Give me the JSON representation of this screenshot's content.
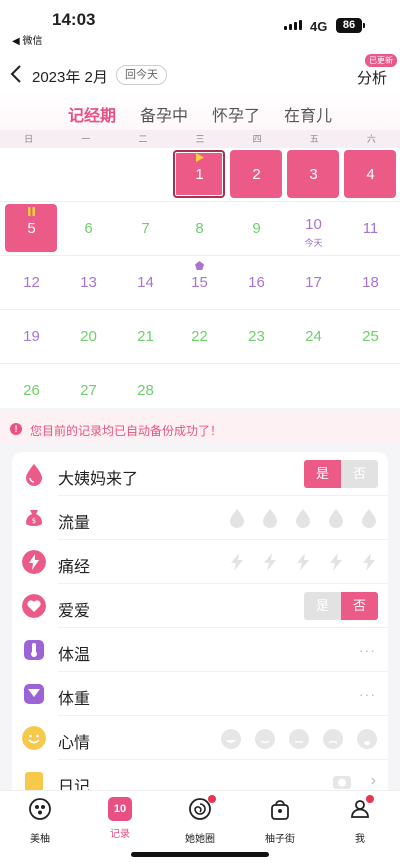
{
  "status_bar": {
    "time": "14:03",
    "back_app": "◀ 微信",
    "network": "4G",
    "battery": "86"
  },
  "header": {
    "title": "2023年 2月",
    "today_button": "回今天",
    "analysis": "分析",
    "updated_badge": "已更新",
    "tabs": [
      "记经期",
      "备孕中",
      "怀孕了",
      "在育儿"
    ]
  },
  "weekdays": [
    "日",
    "一",
    "二",
    "三",
    "四",
    "五",
    "六"
  ],
  "calendar": {
    "today_label": "今天"
  },
  "notice": "您目前的记录均已自动备份成功了！",
  "records": {
    "period_label": "大姨妈来了",
    "yes": "是",
    "no": "否",
    "flow_label": "流量",
    "cramps_label": "痛经",
    "love_label": "爱爱",
    "temperature_label": "体温",
    "weight_label": "体重",
    "mood_label": "心情",
    "diary_label": "日记",
    "more": "···"
  },
  "colors": {
    "accent": "#ec5b88",
    "green_day": "#6fcf6a",
    "purple_day": "#a774d0"
  },
  "tabbar": [
    "美柚",
    "记录",
    "她她圈",
    "柚子街",
    "我"
  ],
  "tabbar_record_icon_text": "10"
}
